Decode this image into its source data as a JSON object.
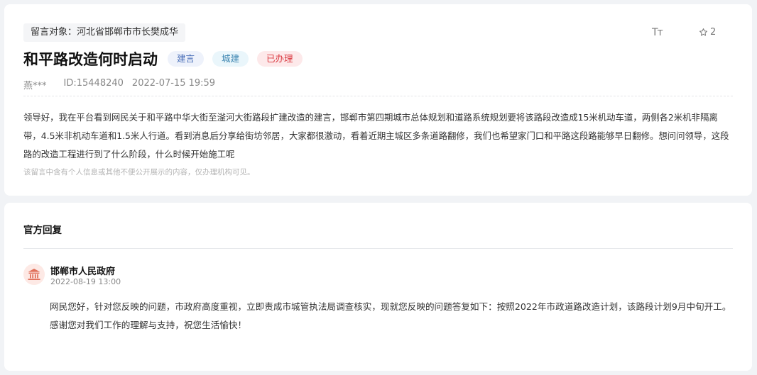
{
  "message": {
    "target_label": "留言对象：河北省邯郸市市长樊成华",
    "title": "和平路改造何时启动",
    "tags": [
      "建言",
      "城建",
      "已办理"
    ],
    "author": "燕***",
    "id_text": "ID:15448240",
    "date": "2022-07-15 19:59",
    "font_size_icon": "Tт",
    "favorite_count": "2",
    "body": "领导好，我在平台看到网民关于和平路中华大街至滏河大街路段扩建改造的建言，邯郸市第四期城市总体规划和道路系统规划要将该路段改造成15米机动车道，两侧各2米机非隔离带，4.5米非机动车道和1.5米人行道。看到消息后分享给街坊邻居，大家都很激动，看着近期主城区多条道路翻修，我们也希望家门口和平路这段路能够早日翻修。想问问领导，这段路的改造工程进行到了什么阶段，什么时候开始施工呢",
    "privacy_note": "该留言中含有个人信息或其他不便公开展示的内容，仅办理机构可见。"
  },
  "reply": {
    "section_title": "官方回复",
    "org_name": "邯郸市人民政府",
    "time": "2022-08-19 13:00",
    "text": "网民您好，针对您反映的问题，市政府高度重视，立即责成市城管执法局调查核实，现就您反映的问题答复如下：按照2022年市政道路改造计划，该路段计划9月中旬开工。感谢您对我们工作的理解与支持，祝您生活愉快！"
  },
  "icons": {
    "font_size": "font-size-icon",
    "favorite": "star-outline-icon",
    "government": "government-building-icon"
  },
  "colors": {
    "tag_suggestion": "#4a6fb8",
    "tag_urban": "#3b84b0",
    "tag_done": "#d9363e",
    "gov_icon": "#e0705a"
  }
}
